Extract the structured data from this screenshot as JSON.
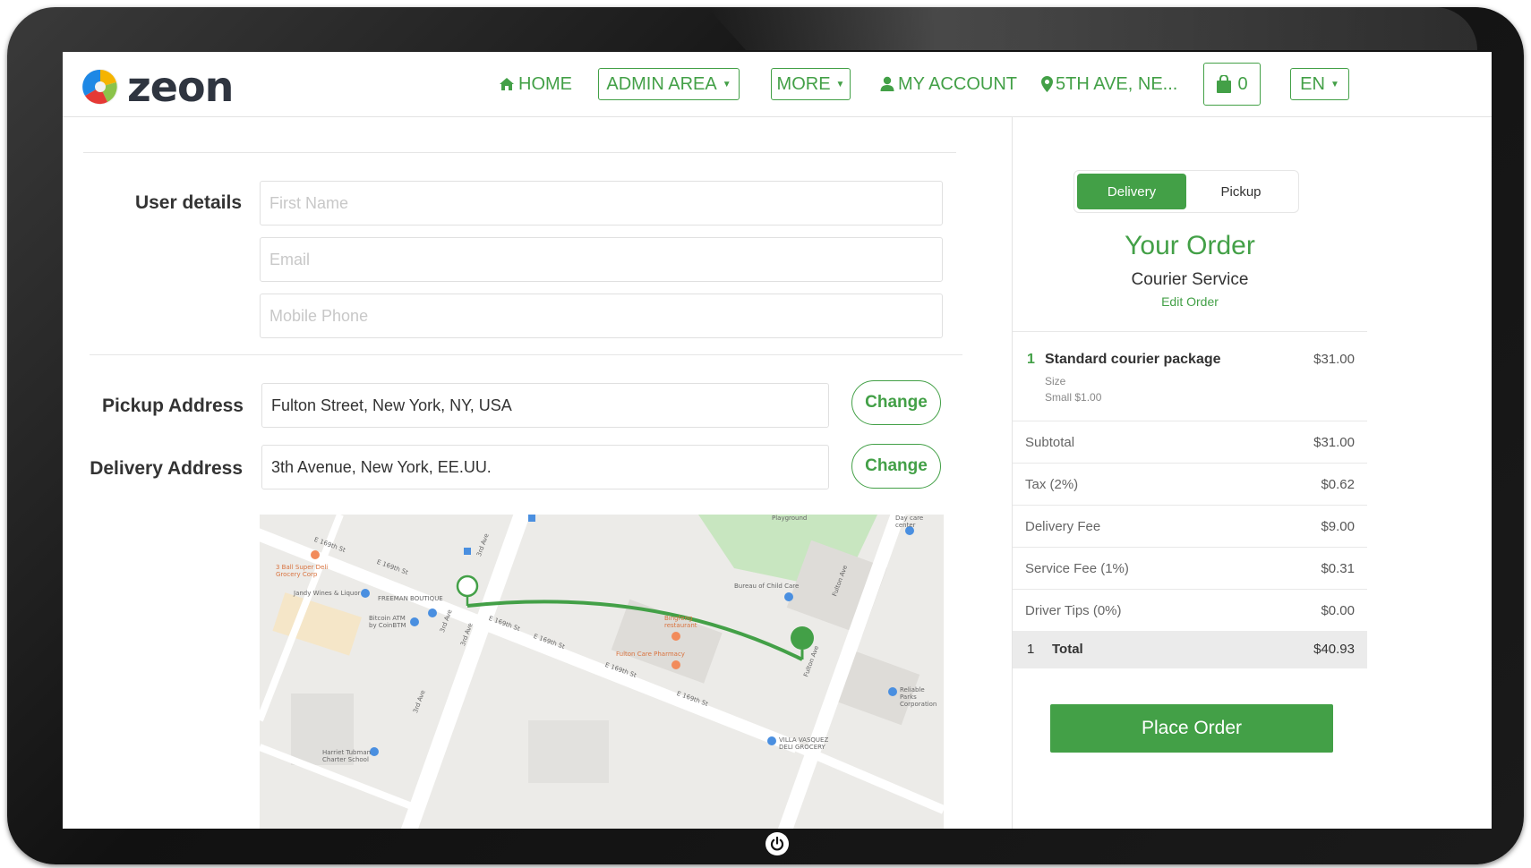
{
  "brand": {
    "name": "zeon"
  },
  "nav": {
    "home": "HOME",
    "admin_area": "ADMIN AREA",
    "more": "MORE",
    "my_account": "MY ACCOUNT",
    "location": "5TH AVE, NE...",
    "cart_count": "0",
    "language": "EN"
  },
  "form": {
    "user_details_label": "User details",
    "first_name_placeholder": "First Name",
    "email_placeholder": "Email",
    "mobile_placeholder": "Mobile Phone",
    "pickup_label": "Pickup Address",
    "pickup_value": "Fulton Street, New York, NY, USA",
    "delivery_label": "Delivery Address",
    "delivery_value": "3th Avenue, New York, EE.UU.",
    "change_label": "Change"
  },
  "map": {
    "labels": {
      "e169_1": "E 169th St",
      "e169_2": "E 169th St",
      "e169_3": "E 169th St",
      "e169_4": "E 169th St",
      "e169_5": "E 169th St",
      "e169_6": "E 169th St",
      "third_ave_1": "3rd Ave",
      "third_ave_2": "3rd Ave",
      "third_ave_3": "3rd Ave",
      "third_ave_4": "3rd Ave",
      "fulton_1": "Fulton Ave",
      "fulton_2": "Fulton Ave",
      "super_deli": "3 Ball Super Deli Grocery Corp",
      "jandy": "Jandy Wines & Liquor",
      "freeman": "FREEMAN BOUTIQUE",
      "bitcoin": "Bitcoin ATM by CoinBTM",
      "child_care": "Bureau of Child Care",
      "pharmacy": "Fulton Care Pharmacy",
      "qingfeng": "Bingfeng restaurant",
      "reliable": "Reliable Parks Corporation",
      "villa": "VILLA VASQUEZ DELI GROCERY",
      "harriet": "Harriet Tubman Charter School",
      "day_care": "Day care center",
      "playground": "Playground"
    }
  },
  "order": {
    "delivery_tab": "Delivery",
    "pickup_tab": "Pickup",
    "title": "Your Order",
    "service": "Courier Service",
    "edit": "Edit Order",
    "item": {
      "qty": "1",
      "name": "Standard courier package",
      "price": "$31.00",
      "option_label": "Size",
      "option_value": "Small $1.00"
    },
    "summary": [
      {
        "label": "Subtotal",
        "value": "$31.00"
      },
      {
        "label": "Tax (2%)",
        "value": "$0.62"
      },
      {
        "label": "Delivery Fee",
        "value": "$9.00"
      },
      {
        "label": "Service Fee (1%)",
        "value": "$0.31"
      },
      {
        "label": "Driver Tips (0%)",
        "value": "$0.00"
      }
    ],
    "total": {
      "qty": "1",
      "label": "Total",
      "value": "$40.93"
    },
    "place_order": "Place Order"
  },
  "colors": {
    "accent": "#43a047",
    "text": "#333333",
    "muted": "#666666"
  }
}
